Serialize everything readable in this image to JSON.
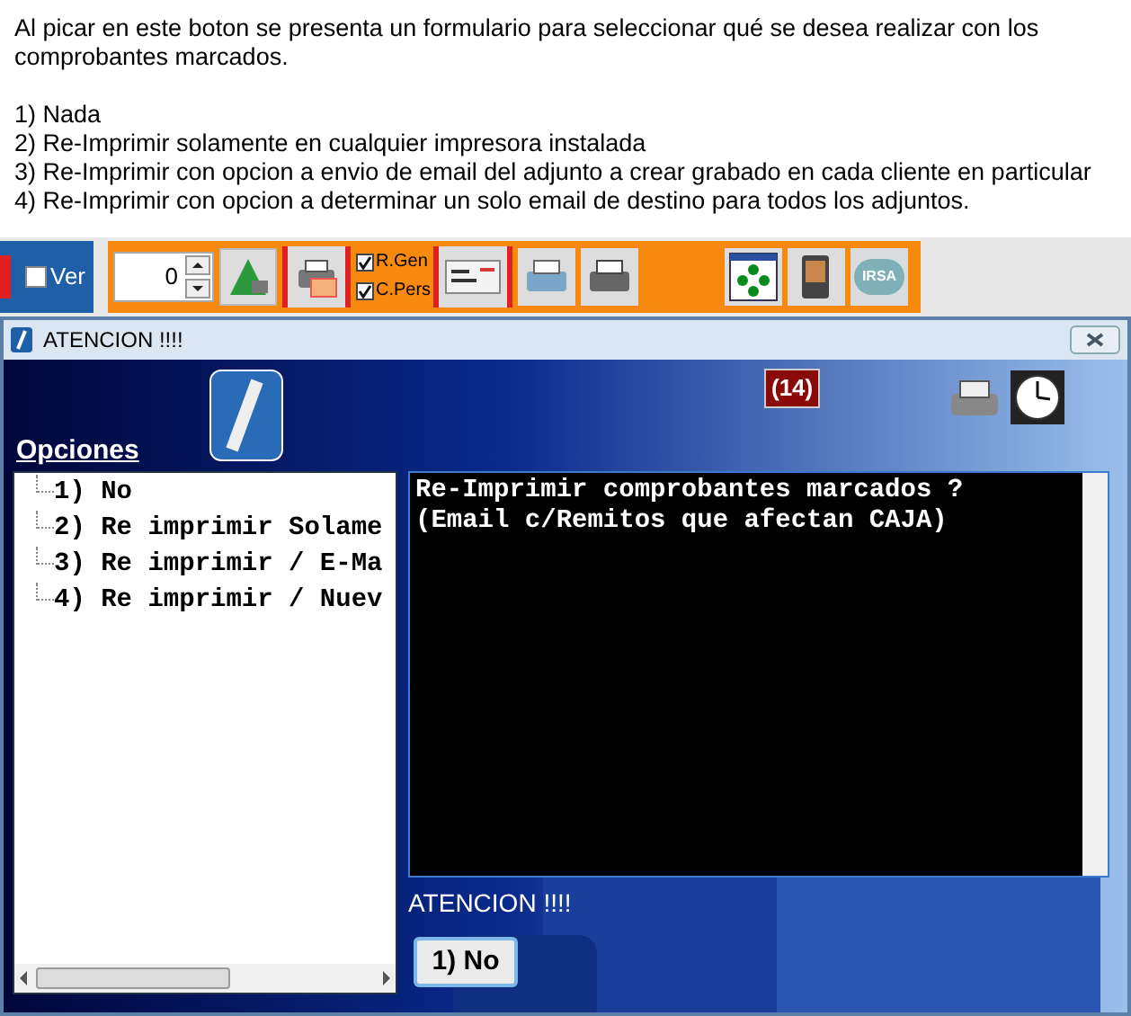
{
  "description": {
    "intro": "Al picar en este boton se presenta un formulario para seleccionar qué se desea realizar con los comprobantes marcados.",
    "options": [
      "1) Nada",
      "2) Re-Imprimir solamente en cualquier impresora instalada",
      "3) Re-Imprimir con opcion a envio de email del adjunto a crear grabado en cada cliente en particular",
      "4) Re-Imprimir con opcion a determinar un solo email de destino para todos los adjuntos."
    ]
  },
  "toolbar": {
    "ver": {
      "label": "Ver",
      "checked": false
    },
    "counter": "0",
    "checks": [
      {
        "label": "R.Gen",
        "checked": true
      },
      {
        "label": "C.Pers",
        "checked": true
      }
    ],
    "logo": "IRSA"
  },
  "dialog": {
    "title": "ATENCION !!!!",
    "counter": "(14)",
    "options_label": "Opciones",
    "tree": [
      {
        "label": "1) No"
      },
      {
        "label": "2) Re imprimir Solame"
      },
      {
        "label": "3) Re imprimir / E-Ma"
      },
      {
        "label": "4) Re imprimir / Nuev"
      }
    ],
    "message": [
      "Re-Imprimir comprobantes marcados ?",
      "(Email c/Remitos que afectan CAJA)"
    ],
    "status": "ATENCION !!!!",
    "button": "1) No"
  }
}
